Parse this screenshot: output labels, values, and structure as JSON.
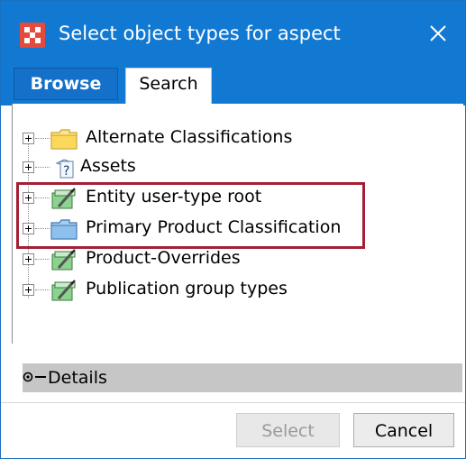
{
  "window": {
    "title": "Select object types for aspect",
    "close_label": "✕"
  },
  "tabs": [
    {
      "label": "Browse",
      "active": true
    },
    {
      "label": "Search",
      "active": false
    }
  ],
  "tree": {
    "items": [
      {
        "label": "Alternate Classifications",
        "icon": "yellow-folder-icon"
      },
      {
        "label": "Assets",
        "icon": "unknown-type-icon"
      },
      {
        "label": "Entity user-type root",
        "icon": "object-type-icon"
      },
      {
        "label": "Primary Product Classification",
        "icon": "blue-folder-icon"
      },
      {
        "label": "Product-Overrides",
        "icon": "object-type-icon"
      },
      {
        "label": "Publication group types",
        "icon": "object-type-icon"
      }
    ]
  },
  "details": {
    "label": "Details"
  },
  "buttons": {
    "select": "Select",
    "cancel": "Cancel"
  },
  "colors": {
    "title_bar": "#1279d3",
    "highlight_box": "#a31f34",
    "app_icon": "#e54a3c"
  }
}
